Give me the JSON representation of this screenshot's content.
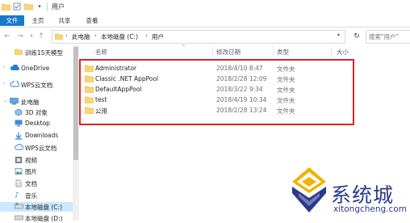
{
  "window": {
    "title": "用户"
  },
  "ribbon": {
    "tabs": {
      "file": "文件",
      "home": "主页",
      "share": "共享",
      "view": "查看"
    }
  },
  "address": {
    "crumbs": [
      "此电脑",
      "本地磁盘 (C:)",
      "用户"
    ]
  },
  "search": {
    "placeholder": "搜索\"用户\""
  },
  "sidebar": {
    "items": [
      {
        "label": "训练15天模型",
        "icon": "folder-icon"
      },
      {
        "label": "OneDrive",
        "icon": "cloud-icon"
      },
      {
        "label": "WPS云文档",
        "icon": "cloud-icon"
      },
      {
        "label": "此电脑",
        "icon": "computer-icon"
      },
      {
        "label": "3D 对象",
        "icon": "cube-icon"
      },
      {
        "label": "Desktop",
        "icon": "desktop-icon"
      },
      {
        "label": "Downloads",
        "icon": "download-icon"
      },
      {
        "label": "WPS云文档",
        "icon": "cloud-icon"
      },
      {
        "label": "视频",
        "icon": "video-icon"
      },
      {
        "label": "图片",
        "icon": "picture-icon"
      },
      {
        "label": "文档",
        "icon": "document-icon"
      },
      {
        "label": "音乐",
        "icon": "music-icon"
      },
      {
        "label": "本地磁盘 (C:)",
        "icon": "drive-icon"
      },
      {
        "label": "本地磁盘 (D:)",
        "icon": "drive-icon"
      }
    ]
  },
  "columns": {
    "name": "名称",
    "modified": "修改日期",
    "type": "类型",
    "size": "大小"
  },
  "files": [
    {
      "name": "Administrator",
      "modified": "2018/4/10 8:47",
      "type": "文件夹"
    },
    {
      "name": "Classic .NET AppPool",
      "modified": "2018/2/28 12:09",
      "type": "文件夹"
    },
    {
      "name": "DefaultAppPool",
      "modified": "2018/3/22 9:34",
      "type": "文件夹"
    },
    {
      "name": "test",
      "modified": "2018/4/19 10:34",
      "type": "文件夹"
    },
    {
      "name": "公用",
      "modified": "2018/2/28 13:24",
      "type": "文件夹"
    }
  ],
  "watermark": {
    "text": "系统城",
    "url": "xitongcheng.com"
  },
  "colors": {
    "accent": "#1979ca",
    "highlight_border": "#d8262a",
    "folder": "#f8d775",
    "watermark": "#2b3a8f"
  }
}
